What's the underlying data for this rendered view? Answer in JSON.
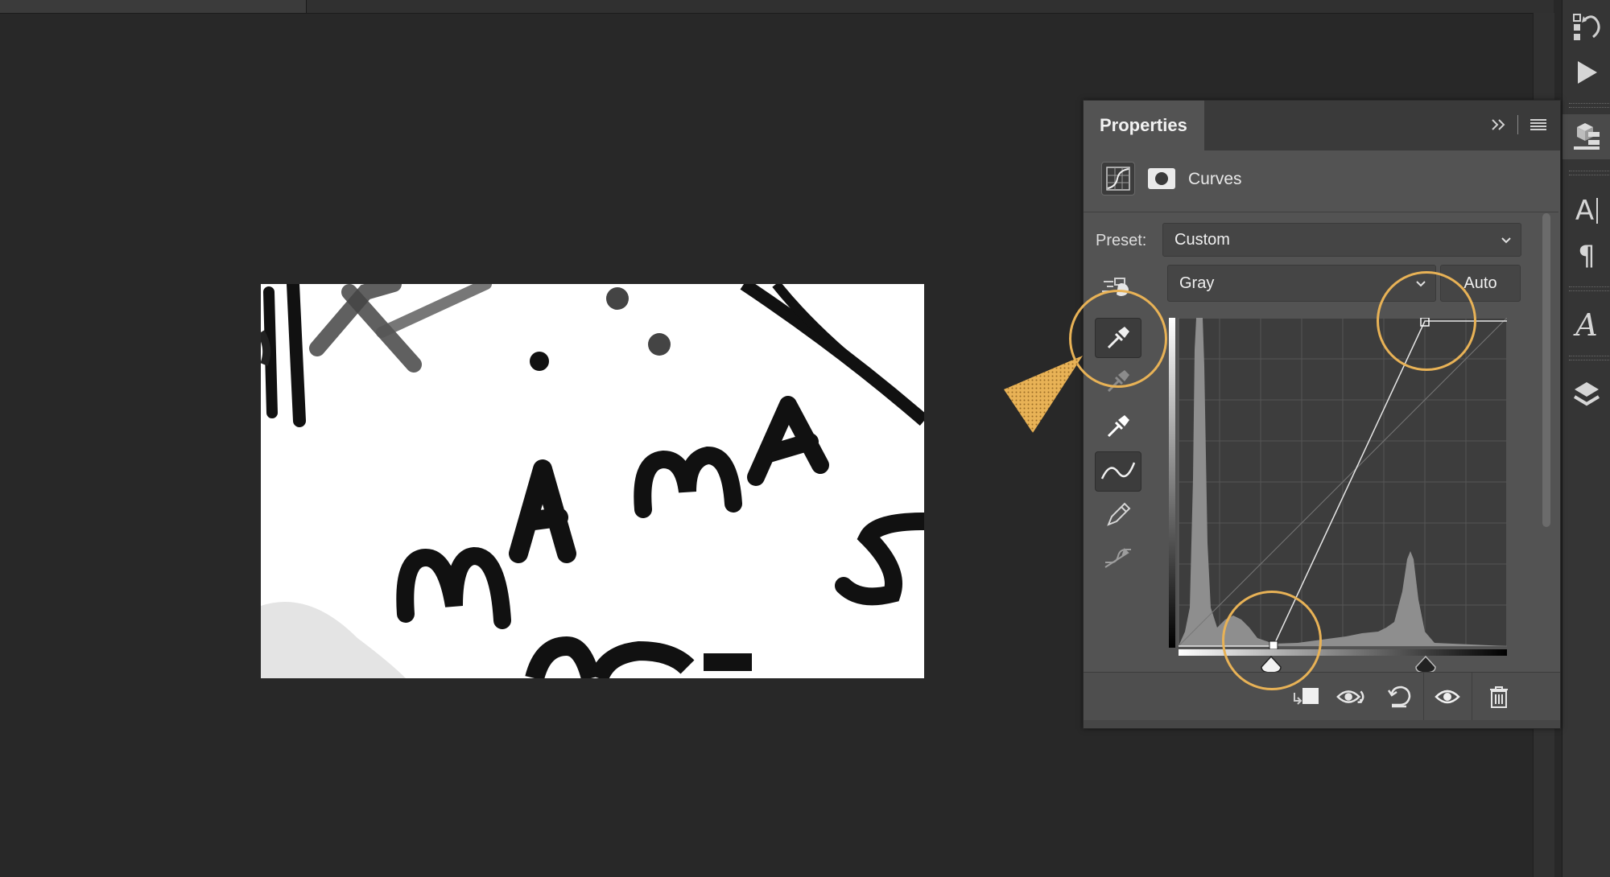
{
  "panel": {
    "title": "Properties",
    "adjustment_type": "Curves",
    "preset_label": "Preset:",
    "preset_value": "Custom",
    "channel_value": "Gray",
    "auto_label": "Auto"
  },
  "icons": {
    "header": [
      "expand-arrows-icon",
      "panel-menu-icon"
    ],
    "type": [
      "curves-adjustment-icon",
      "layer-mask-icon"
    ],
    "tools": [
      "on-image-adjust-icon",
      "sample-black-point-icon",
      "sample-gray-point-icon",
      "sample-white-point-icon",
      "curve-points-icon",
      "pencil-draw-icon",
      "smooth-curve-icon"
    ],
    "footer": [
      "clip-to-layer-icon",
      "view-previous-state-icon",
      "reset-icon",
      "visibility-icon",
      "delete-icon"
    ],
    "dock": [
      "history-icon",
      "play-actions-icon",
      "3d-properties-icon",
      "character-icon",
      "paragraph-icon",
      "glyphs-icon",
      "layers-icon"
    ]
  },
  "colors": {
    "accent": "#e8b256",
    "panel_bg": "#535353",
    "canvas_bg": "#282828"
  },
  "curve": {
    "black_point_input": 30,
    "white_point_input": 77,
    "histogram_peaks": [
      "dark",
      "light"
    ]
  }
}
